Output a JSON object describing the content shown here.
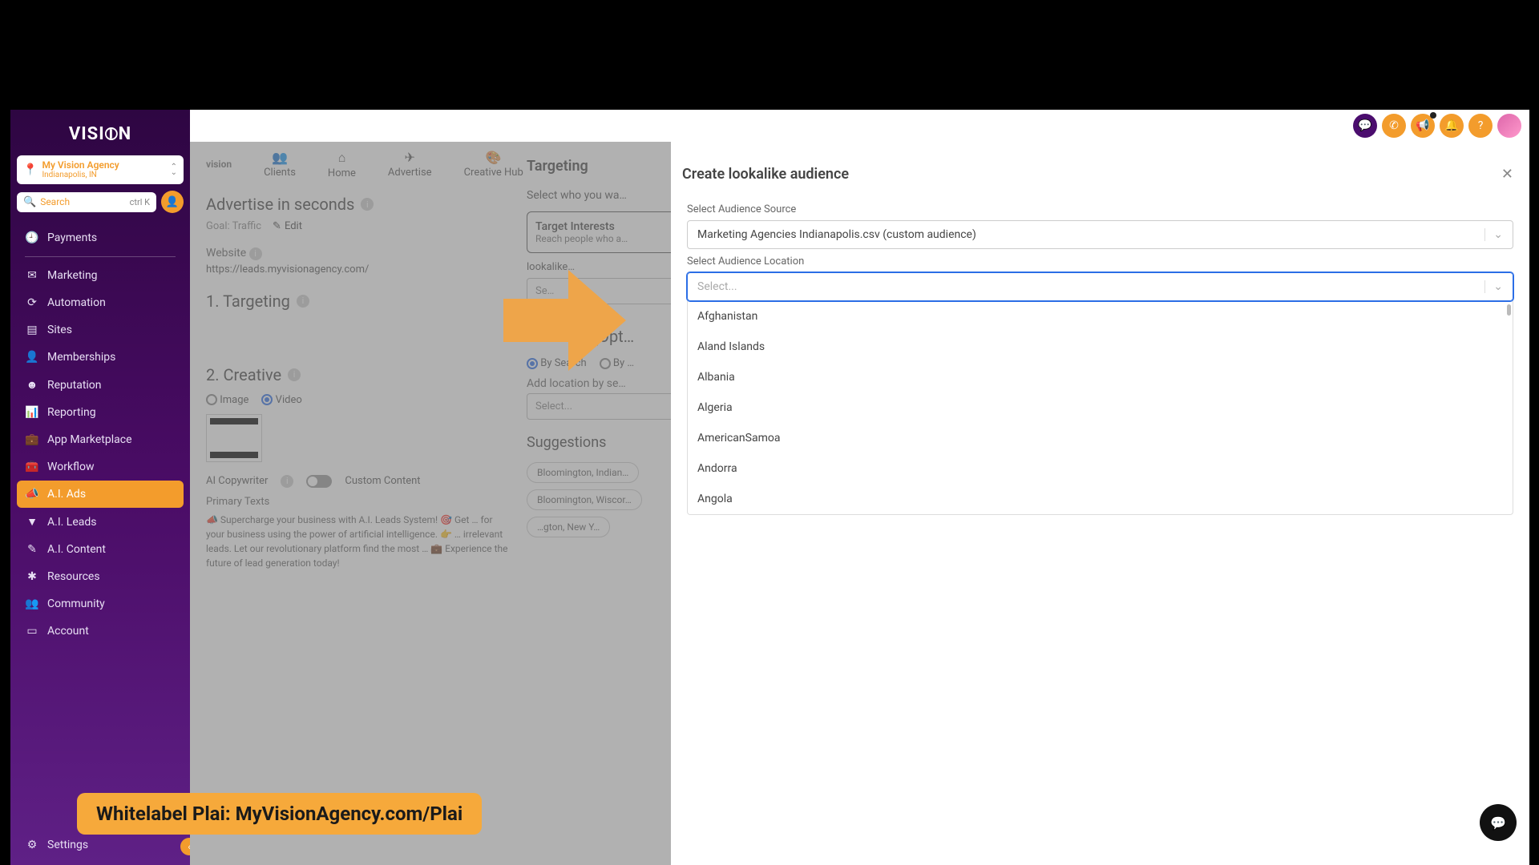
{
  "brand": {
    "logo": "VISI⦶N"
  },
  "agency": {
    "name": "My Vision Agency",
    "location": "Indianapolis, IN"
  },
  "search": {
    "placeholder": "Search",
    "shortcut": "ctrl K"
  },
  "sidebar": {
    "items": [
      {
        "icon": "⚙",
        "label": "Payments"
      },
      {
        "icon": "✉",
        "label": "Marketing"
      },
      {
        "icon": "⟳",
        "label": "Automation"
      },
      {
        "icon": "▤",
        "label": "Sites"
      },
      {
        "icon": "☺",
        "label": "Memberships"
      },
      {
        "icon": "☻",
        "label": "Reputation"
      },
      {
        "icon": "▮",
        "label": "Reporting"
      },
      {
        "icon": "⧉",
        "label": "App Marketplace"
      },
      {
        "icon": "≡",
        "label": "Workflow"
      },
      {
        "icon": "📣",
        "label": "A.I. Ads"
      },
      {
        "icon": "▼",
        "label": "A.I. Leads"
      },
      {
        "icon": "✎",
        "label": "A.I. Content"
      },
      {
        "icon": "✱",
        "label": "Resources"
      },
      {
        "icon": "👥",
        "label": "Community"
      },
      {
        "icon": "▭",
        "label": "Account"
      }
    ],
    "settings": {
      "icon": "⚙",
      "label": "Settings"
    }
  },
  "inner_nav": {
    "logo": "vision",
    "tabs": [
      {
        "icon": "👥",
        "label": "Clients"
      },
      {
        "icon": "⌂",
        "label": "Home"
      },
      {
        "icon": "✈",
        "label": "Advertise"
      },
      {
        "icon": "🎨",
        "label": "Creative Hub"
      }
    ]
  },
  "advertise": {
    "heading": "Advertise in seconds",
    "goal_label": "Goal: Traffic",
    "edit": "Edit",
    "website_label": "Website",
    "website_value": "https://leads.myvisionagency.com/",
    "targeting_heading": "1.  Targeting",
    "creative_heading": "2. Creative",
    "image_opt": "Image",
    "video_opt": "Video",
    "ai_copy": "AI Copywriter",
    "custom_content": "Custom Content",
    "primary_texts": "Primary Texts",
    "pt_body": "📣 Supercharge your business with A.I. Leads System! 🎯 Get … for your business using the power of artificial intelligence. 👉 … irrelevant leads. Let our revolutionary platform find the most … 💼 Experience the future of lead generation today!"
  },
  "targeting_panel": {
    "heading": "Targeting",
    "sub": "Select who you wa…",
    "interest_title": "Target Interests",
    "interest_desc": "Reach people who a…",
    "lookalike_hint": "lookalike…",
    "select_ph": "Se…",
    "location_heading": "Location (Opt…",
    "by_search": "By Search",
    "by_other": "By …",
    "add_loc_label": "Add location by se…",
    "add_loc_ph": "Select...",
    "suggestions_heading": "Suggestions",
    "suggestions": [
      "Bloomington, Indian…",
      "Bloomington, Wiscor…",
      "…gton, New Y…"
    ]
  },
  "modal": {
    "title": "Create lookalike audience",
    "source_label": "Select Audience Source",
    "source_value": "Marketing Agencies Indianapolis.csv (custom audience)",
    "location_label": "Select Audience Location",
    "location_placeholder": "Select...",
    "options": [
      "Afghanistan",
      "Aland Islands",
      "Albania",
      "Algeria",
      "AmericanSamoa",
      "Andorra",
      "Angola"
    ]
  },
  "banner": "Whitelabel Plai: MyVisionAgency.com/Plai"
}
